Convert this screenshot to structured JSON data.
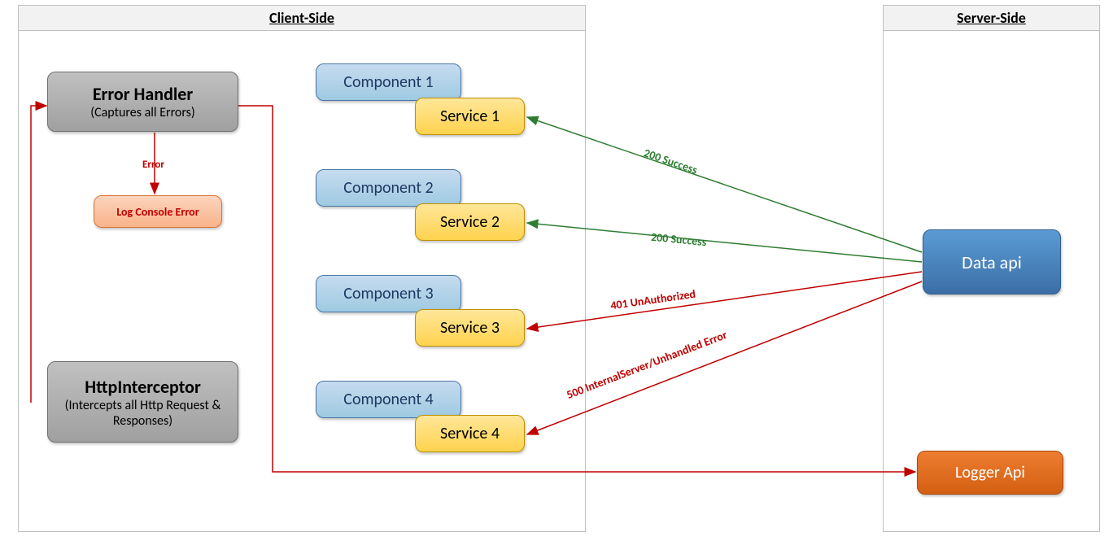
{
  "clientSide": {
    "title": "Client-Side",
    "errorHandler": {
      "title": "Error Handler",
      "subtitle": "(Captures all Errors)"
    },
    "errorArrowLabel": "Error",
    "logConsole": "Log Console Error",
    "httpInterceptor": {
      "title": "HttpInterceptor",
      "subtitle": "(Intercepts all Http Request & Responses)"
    },
    "components": [
      {
        "component": "Component 1",
        "service": "Service 1"
      },
      {
        "component": "Component 2",
        "service": "Service 2"
      },
      {
        "component": "Component 3",
        "service": "Service 3"
      },
      {
        "component": "Component 4",
        "service": "Service 4"
      }
    ]
  },
  "serverSide": {
    "title": "Server-Side",
    "dataApi": "Data api",
    "loggerApi": "Logger Api"
  },
  "edges": {
    "s1": "200 Success",
    "s2": "200 Success",
    "s3": "401 UnAuthorized",
    "s4": "500 InternalServer/Unhandled Error"
  }
}
